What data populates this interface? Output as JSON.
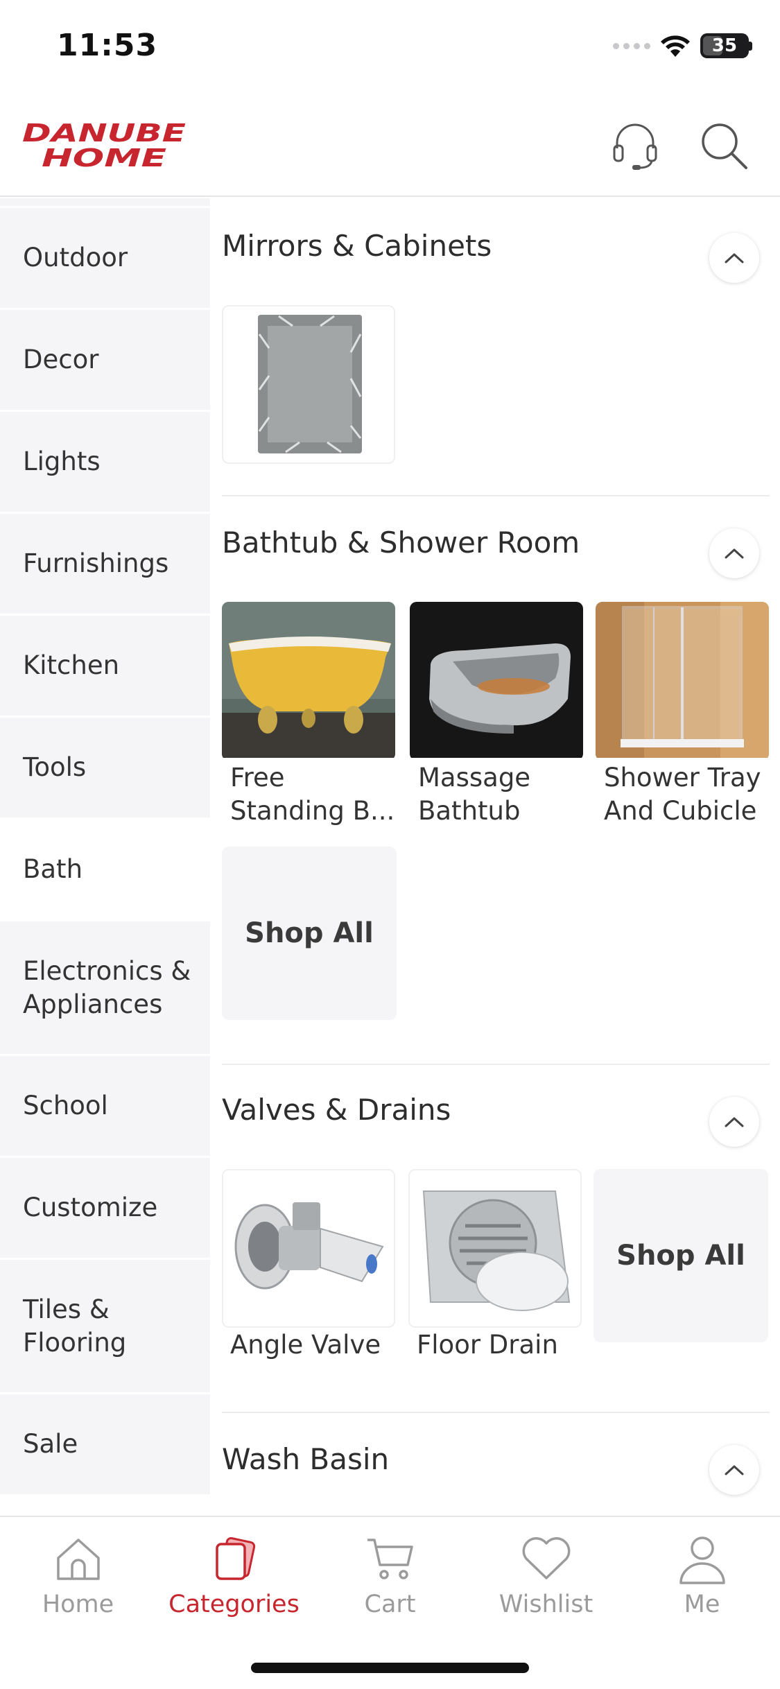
{
  "status_bar": {
    "time": "11:53",
    "battery": "35"
  },
  "header": {
    "logo_line1": "DANUBE",
    "logo_line2": "HOME"
  },
  "sidebar": {
    "items": [
      {
        "label": "Outdoor",
        "active": false
      },
      {
        "label": "Decor",
        "active": false
      },
      {
        "label": "Lights",
        "active": false
      },
      {
        "label": "Furnishings",
        "active": false
      },
      {
        "label": "Kitchen",
        "active": false
      },
      {
        "label": "Tools",
        "active": false
      },
      {
        "label": "Bath",
        "active": true
      },
      {
        "label": "Electronics & Appliances",
        "active": false
      },
      {
        "label": "School",
        "active": false
      },
      {
        "label": "Customize",
        "active": false
      },
      {
        "label": "Tiles & Flooring",
        "active": false
      },
      {
        "label": "Sale",
        "active": false
      }
    ]
  },
  "sections": [
    {
      "title": "Mirrors & Cabinets",
      "products": [
        {
          "label": ""
        }
      ]
    },
    {
      "title": "Bathtub & Shower Room",
      "products": [
        {
          "label": "Free Standing B..."
        },
        {
          "label": "Massage Bathtub"
        },
        {
          "label": "Shower Tray And Cubicle"
        }
      ],
      "shop_all": "Shop All"
    },
    {
      "title": "Valves & Drains",
      "products": [
        {
          "label": "Angle Valve"
        },
        {
          "label": "Floor Drain"
        }
      ],
      "shop_all": "Shop All"
    },
    {
      "title": "Wash Basin",
      "products": []
    }
  ],
  "bottom_nav": {
    "items": [
      {
        "label": "Home",
        "icon": "home-icon",
        "active": false
      },
      {
        "label": "Categories",
        "icon": "categories-icon",
        "active": true
      },
      {
        "label": "Cart",
        "icon": "cart-icon",
        "active": false
      },
      {
        "label": "Wishlist",
        "icon": "heart-icon",
        "active": false
      },
      {
        "label": "Me",
        "icon": "profile-icon",
        "active": false
      }
    ]
  },
  "colors": {
    "brand": "#c8262f",
    "sidebar_bg": "#f5f5f7",
    "text": "#333333",
    "muted": "#9b9b9b"
  }
}
